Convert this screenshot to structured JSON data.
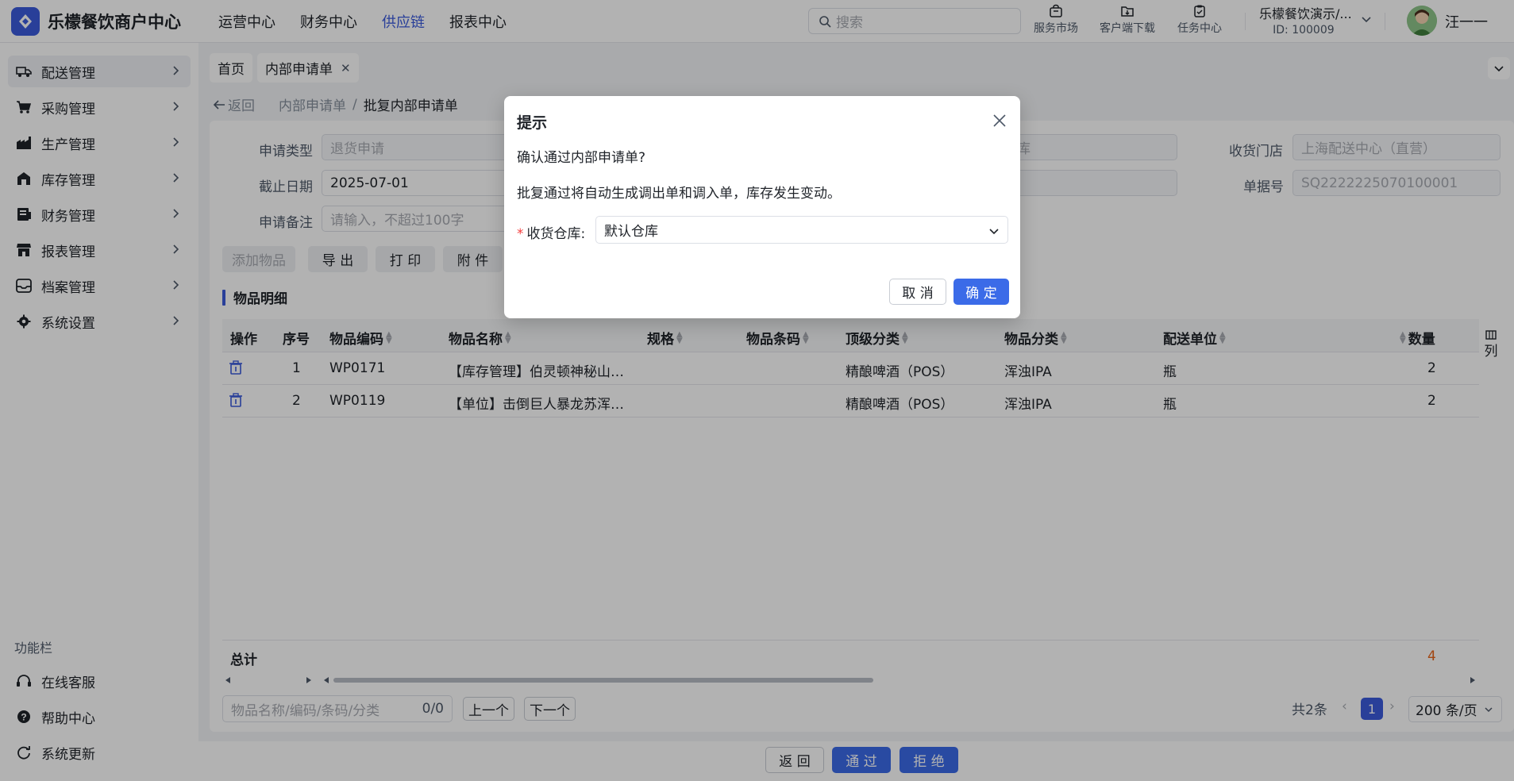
{
  "brand": {
    "name": "乐檬餐饮商户中心",
    "color": "#3b5bdb"
  },
  "topnav": [
    {
      "label": "运营中心",
      "active": false
    },
    {
      "label": "财务中心",
      "active": false
    },
    {
      "label": "供应链",
      "active": true
    },
    {
      "label": "报表中心",
      "active": false
    }
  ],
  "search": {
    "placeholder": "搜索"
  },
  "tools": [
    {
      "label": "服务市场",
      "icon": "shop-bag-icon"
    },
    {
      "label": "客户端下载",
      "icon": "folder-download-icon"
    },
    {
      "label": "任务中心",
      "icon": "clipboard-check-icon"
    }
  ],
  "org": {
    "name": "乐檬餐饮演示/...",
    "id": "ID: 100009"
  },
  "user": {
    "name": "汪一一"
  },
  "sidebar": {
    "items": [
      {
        "label": "配送管理",
        "icon": "truck-icon",
        "active": true
      },
      {
        "label": "采购管理",
        "icon": "cart-icon",
        "active": false
      },
      {
        "label": "生产管理",
        "icon": "factory-icon",
        "active": false
      },
      {
        "label": "库存管理",
        "icon": "warehouse-icon",
        "active": false
      },
      {
        "label": "财务管理",
        "icon": "ledger-icon",
        "active": false
      },
      {
        "label": "报表管理",
        "icon": "store-icon",
        "active": false
      },
      {
        "label": "档案管理",
        "icon": "archive-icon",
        "active": false
      },
      {
        "label": "系统设置",
        "icon": "gear-icon",
        "active": false
      }
    ],
    "caption": "功能栏",
    "footer": [
      {
        "label": "在线客服",
        "icon": "headset-icon"
      },
      {
        "label": "帮助中心",
        "icon": "help-icon"
      },
      {
        "label": "系统更新",
        "icon": "refresh-icon"
      }
    ]
  },
  "tabs": [
    {
      "label": "首页"
    },
    {
      "label": "内部申请单",
      "closable": true
    }
  ],
  "breadcrumb": {
    "back": "返回",
    "parent": "内部申请单",
    "separator": "/",
    "current": "批复内部申请单"
  },
  "form": {
    "apply_type": {
      "label": "申请类型",
      "value": "退货申请"
    },
    "deadline": {
      "label": "截止日期",
      "value": "2025-07-01"
    },
    "remark": {
      "label": "申请备注",
      "placeholder": "请输入，不超过100字"
    },
    "warehouse_partial": "库",
    "store": {
      "label": "收货门店",
      "value": "上海配送中心（直营）"
    },
    "doc_no": {
      "label": "单据号",
      "value": "SQ2222225070100001"
    }
  },
  "actions": {
    "add": "添加物品",
    "export": "导 出",
    "print": "打 印",
    "attach": "附 件"
  },
  "detail": {
    "title": "物品明细",
    "columns": [
      "操作",
      "序号",
      "物品编码",
      "物品名称",
      "规格",
      "物品条码",
      "顶级分类",
      "物品分类",
      "配送单位",
      "数量"
    ],
    "col_settings": "列",
    "rows": [
      {
        "no": "1",
        "code": "WP0171",
        "name": "【库存管理】伯灵顿神秘山…",
        "spec": "",
        "barcode": "",
        "top_cat": "精酿啤酒（POS）",
        "cat": "浑浊IPA",
        "unit": "瓶",
        "qty": "2"
      },
      {
        "no": "2",
        "code": "WP0119",
        "name": "【单位】击倒巨人暴龙苏浑…",
        "spec": "",
        "barcode": "",
        "top_cat": "精酿啤酒（POS）",
        "cat": "浑浊IPA",
        "unit": "瓶",
        "qty": "2"
      }
    ],
    "total_label": "总计",
    "total_qty": "4"
  },
  "finder": {
    "placeholder": "物品名称/编码/条码/分类",
    "count": "0/0",
    "prev": "上一个",
    "next": "下一个"
  },
  "pagination": {
    "total": "共2条",
    "current": "1",
    "page_size": "200 条/页"
  },
  "bottom": {
    "back": "返 回",
    "approve": "通 过",
    "reject": "拒 绝"
  },
  "dialog": {
    "title": "提示",
    "question": "确认通过内部申请单?",
    "note": "批复通过将自动生成调出单和调入单，库存发生变动。",
    "field_label": "收货仓库:",
    "field_value": "默认仓库",
    "cancel": "取 消",
    "confirm": "确 定"
  }
}
